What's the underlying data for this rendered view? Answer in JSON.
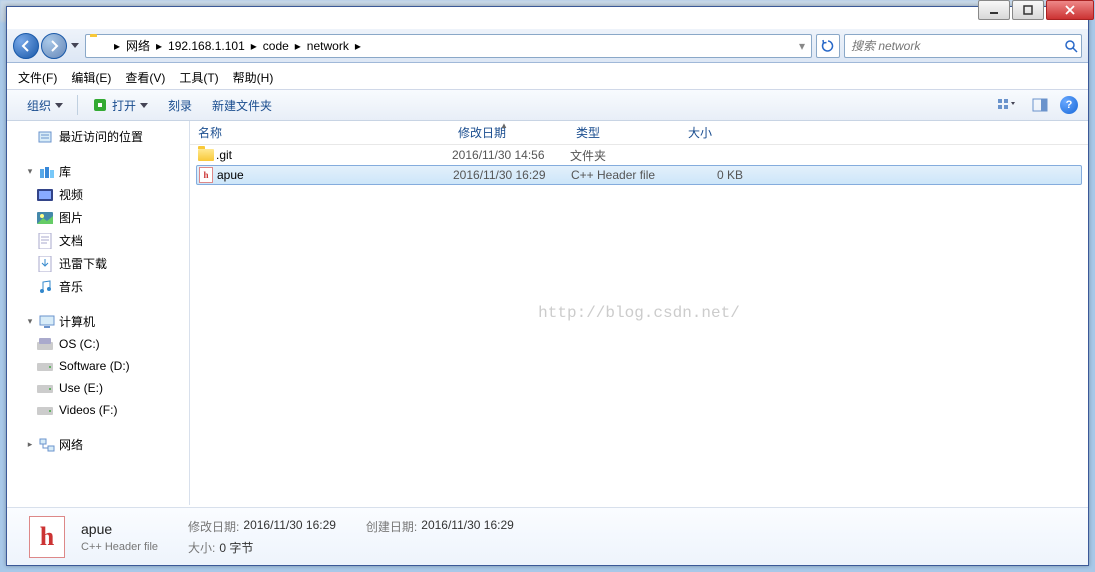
{
  "window_controls": {
    "min": "min",
    "max": "max",
    "close": "close"
  },
  "breadcrumb": {
    "items": [
      "网络",
      "192.168.1.101",
      "code",
      "network"
    ]
  },
  "search": {
    "placeholder": "搜索 network"
  },
  "menubar": {
    "items": [
      "文件(F)",
      "编辑(E)",
      "查看(V)",
      "工具(T)",
      "帮助(H)"
    ]
  },
  "toolbar": {
    "organize": "组织",
    "open": "打开",
    "burn": "刻录",
    "newfolder": "新建文件夹"
  },
  "sidebar": {
    "recent": "最近访问的位置",
    "libraries": "库",
    "lib_items": [
      "视频",
      "图片",
      "文档",
      "迅雷下载",
      "音乐"
    ],
    "computer": "计算机",
    "drives": [
      "OS (C:)",
      "Software (D:)",
      "Use (E:)",
      "Videos (F:)"
    ],
    "network": "网络"
  },
  "columns": {
    "name": "名称",
    "date": "修改日期",
    "type": "类型",
    "size": "大小"
  },
  "files": [
    {
      "icon": "folder",
      "name": ".git",
      "date": "2016/11/30 14:56",
      "type": "文件夹",
      "size": "",
      "selected": false
    },
    {
      "icon": "hfile",
      "name": "apue",
      "date": "2016/11/30 16:29",
      "type": "C++ Header file",
      "size": "0 KB",
      "selected": true
    }
  ],
  "watermark": "http://blog.csdn.net/",
  "details": {
    "name": "apue",
    "type": "C++ Header file",
    "modified_label": "修改日期:",
    "modified_value": "2016/11/30 16:29",
    "created_label": "创建日期:",
    "created_value": "2016/11/30 16:29",
    "size_label": "大小:",
    "size_value": "0 字节"
  }
}
